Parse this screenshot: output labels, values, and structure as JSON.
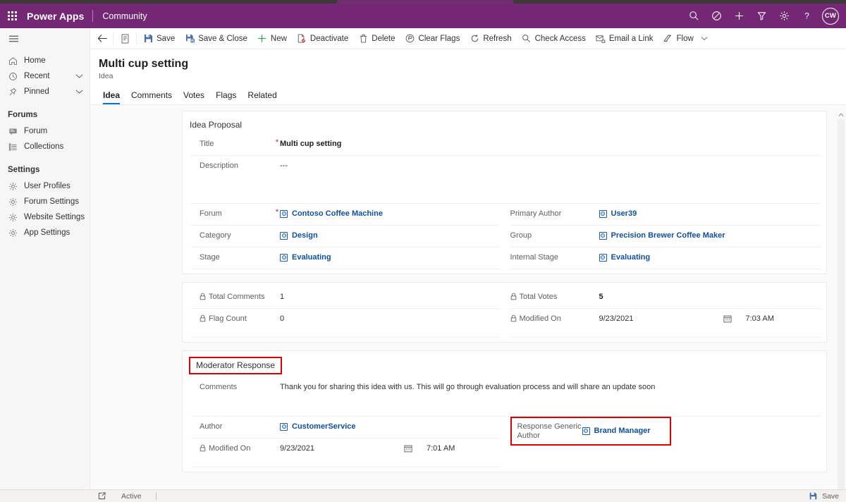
{
  "header": {
    "brand": "Power Apps",
    "app_name": "Community",
    "accent_color": "#742774",
    "icons": [
      "search-icon",
      "assistant-icon",
      "plus-icon",
      "filter-icon",
      "gear-icon",
      "help-icon"
    ],
    "avatar_initials": "CW"
  },
  "sidebar": {
    "items": [
      {
        "label": "Home",
        "icon": "home-icon",
        "expandable": false
      },
      {
        "label": "Recent",
        "icon": "clock-icon",
        "expandable": true
      },
      {
        "label": "Pinned",
        "icon": "pin-icon",
        "expandable": true
      }
    ],
    "groups": [
      {
        "title": "Forums",
        "items": [
          {
            "label": "Forum",
            "icon": "forum-icon"
          },
          {
            "label": "Collections",
            "icon": "collections-icon"
          }
        ]
      },
      {
        "title": "Settings",
        "items": [
          {
            "label": "User Profiles",
            "icon": "gear-icon"
          },
          {
            "label": "Forum Settings",
            "icon": "gear-icon"
          },
          {
            "label": "Website Settings",
            "icon": "gear-icon"
          },
          {
            "label": "App Settings",
            "icon": "gear-icon"
          }
        ]
      }
    ]
  },
  "commandbar": {
    "back": "back-arrow-icon",
    "form_selector": "form-icon",
    "buttons": [
      {
        "label": "Save",
        "icon": "save-icon"
      },
      {
        "label": "Save & Close",
        "icon": "save-close-icon"
      },
      {
        "label": "New",
        "icon": "plus-icon"
      },
      {
        "label": "Deactivate",
        "icon": "deactivate-icon"
      },
      {
        "label": "Delete",
        "icon": "trash-icon"
      },
      {
        "label": "Clear Flags",
        "icon": "clear-flags-icon"
      },
      {
        "label": "Refresh",
        "icon": "refresh-icon"
      },
      {
        "label": "Check Access",
        "icon": "check-access-icon"
      },
      {
        "label": "Email a Link",
        "icon": "email-link-icon"
      },
      {
        "label": "Flow",
        "icon": "flow-icon",
        "has_chevron": true
      }
    ]
  },
  "record": {
    "title": "Multi cup setting",
    "entity": "Idea",
    "tabs": [
      {
        "label": "Idea",
        "active": true
      },
      {
        "label": "Comments",
        "active": false
      },
      {
        "label": "Votes",
        "active": false
      },
      {
        "label": "Flags",
        "active": false
      },
      {
        "label": "Related",
        "active": false
      }
    ]
  },
  "sections": {
    "idea_proposal": {
      "title": "Idea Proposal",
      "title_highlighted": false,
      "fields_top": [
        {
          "label": "Title",
          "required": true,
          "value": "Multi cup setting",
          "type": "text-bold"
        },
        {
          "label": "Description",
          "required": false,
          "value": "---",
          "type": "text"
        }
      ],
      "left": [
        {
          "label": "Forum",
          "required": true,
          "value": "Contoso Coffee Machine",
          "type": "lookup"
        },
        {
          "label": "Category",
          "required": false,
          "value": "Design",
          "type": "lookup"
        },
        {
          "label": "Stage",
          "required": false,
          "value": "Evaluating",
          "type": "lookup"
        }
      ],
      "right": [
        {
          "label": "Primary Author",
          "required": false,
          "value": "User39",
          "type": "lookup"
        },
        {
          "label": "Group",
          "required": false,
          "value": "Precision Brewer Coffee Maker",
          "type": "lookup"
        },
        {
          "label": "Internal Stage",
          "required": false,
          "value": "Evaluating",
          "type": "lookup"
        }
      ]
    },
    "stats": {
      "left": [
        {
          "label": "Total Comments",
          "value": "1",
          "locked": true,
          "type": "text"
        },
        {
          "label": "Flag Count",
          "value": "0",
          "locked": true,
          "type": "text"
        }
      ],
      "right": [
        {
          "label": "Total Votes",
          "value": "5",
          "locked": true,
          "type": "text"
        },
        {
          "label": "Modified On",
          "value": "9/23/2021",
          "time": "7:03 AM",
          "locked": true,
          "type": "datetime"
        }
      ]
    },
    "moderator_response": {
      "title": "Moderator Response",
      "title_highlighted": true,
      "comments_label": "Comments",
      "comments_value": "Thank you for sharing this idea with us. This will go through evaluation process and will share an update soon",
      "left": [
        {
          "label": "Author",
          "value": "CustomerService",
          "type": "lookup",
          "locked": false
        },
        {
          "label": "Modified On",
          "value": "9/23/2021",
          "time": "7:01 AM",
          "type": "datetime",
          "locked": true
        }
      ],
      "right": [
        {
          "label": "Response Generic Author",
          "value": "Brand Manager",
          "type": "lookup",
          "highlighted": true
        }
      ]
    }
  },
  "highlight_color": "#e00000",
  "footer": {
    "icon": "open-popup-icon",
    "status": "Active",
    "save_label": "Save",
    "save_icon": "save-icon"
  }
}
